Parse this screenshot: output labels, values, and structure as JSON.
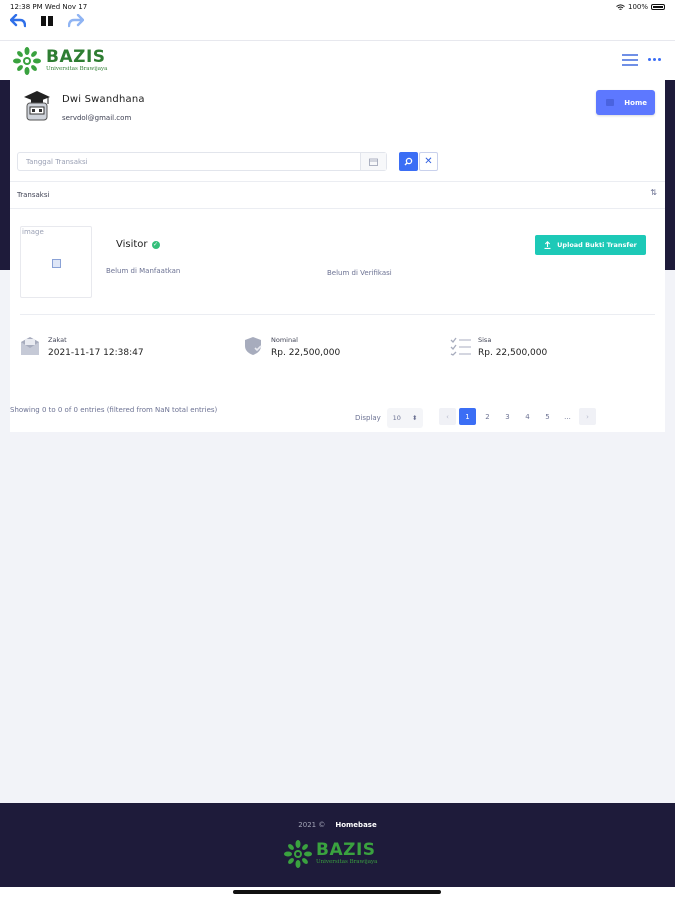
{
  "statusbar": {
    "time": "12:38 PM   Wed Nov 17",
    "battery": "100%"
  },
  "header": {
    "logo_title": "BAZIS",
    "logo_subtitle": "Universitas Brawijaya"
  },
  "user": {
    "name": "Dwi Swandhana",
    "email": "servdol@gmail.com",
    "home_label": "Home"
  },
  "filter": {
    "date_placeholder": "Tanggal Transaksi"
  },
  "table": {
    "column_label": "Transaksi"
  },
  "transaction": {
    "image_alt": "image",
    "status_title": "Visitor",
    "status_used": "Belum di Manfaatkan",
    "status_verified": "Belum di Verifikasi",
    "upload_label": "Upload Bukti Transfer",
    "stats": [
      {
        "label": "Zakat",
        "value": "2021-11-17 12:38:47",
        "icon": "envelope-icon"
      },
      {
        "label": "Nominal",
        "value": "Rp. 22,500,000",
        "icon": "shield-icon"
      },
      {
        "label": "Sisa",
        "value": "Rp. 22,500,000",
        "icon": "checklist-icon"
      }
    ]
  },
  "pagination": {
    "info": "Showing 0 to 0 of 0 entries (filtered from NaN total entries)",
    "display_label": "Display",
    "page_size": "10",
    "pages": [
      "1",
      "2",
      "3",
      "4",
      "5",
      "..."
    ]
  },
  "footer": {
    "year": "2021 ©",
    "brand": "Homebase",
    "logo_title": "BAZIS",
    "logo_subtitle": "Universitas Brawijaya"
  },
  "colors": {
    "primary": "#3b6ef5",
    "home_button": "#5d78ff",
    "upload_button": "#1dc9b7",
    "dark_band": "#1e1b3a",
    "logo_green": "#2e7d32",
    "verified_green": "#34bf7a"
  }
}
